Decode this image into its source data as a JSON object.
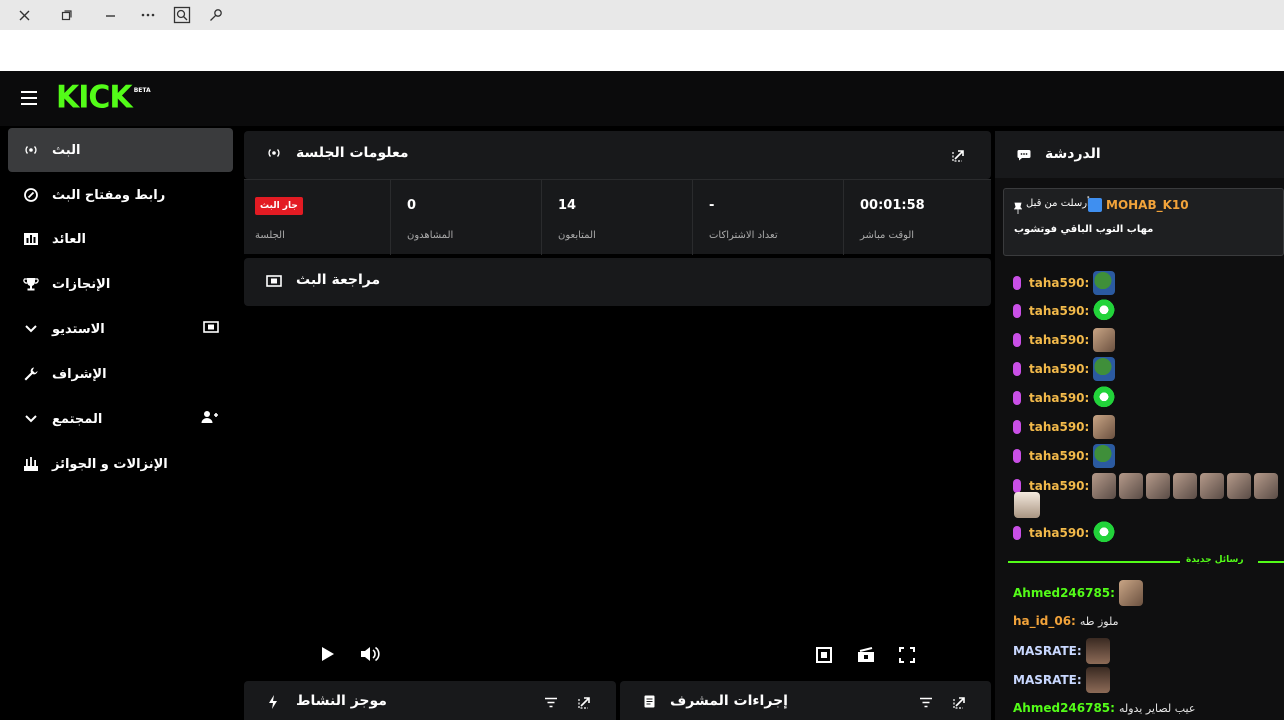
{
  "topbar": {
    "icons": [
      "close-icon",
      "restore-icon",
      "minimize-icon",
      "more-icon",
      "zoom-icon",
      "key-icon"
    ]
  },
  "header": {
    "logo": "KICK",
    "logo_badge": "BETA"
  },
  "sidebar": {
    "items": [
      {
        "label": "البث",
        "icon": "broadcast-icon",
        "active": true
      },
      {
        "label": "رابط ومفتاح البث",
        "icon": "link-icon"
      },
      {
        "label": "العائد",
        "icon": "chart-icon"
      },
      {
        "label": "الإنجازات",
        "icon": "trophy-icon"
      },
      {
        "label": "الاستديو",
        "icon": "studio-icon",
        "expandable": true
      },
      {
        "label": "الإشراف",
        "icon": "wrench-icon"
      },
      {
        "label": "المجتمع",
        "icon": "community-icon",
        "expandable": true
      },
      {
        "label": "الإنزالات و الجوائز",
        "icon": "gift-icon"
      }
    ]
  },
  "session_panel": {
    "title": "معلومات الجلسة",
    "stats": [
      {
        "value": "00:01:58",
        "label": "الوقت مباشر"
      },
      {
        "value": "-",
        "label": "تعداد الاشتراكات"
      },
      {
        "value": "14",
        "label": "المتابعون"
      },
      {
        "value": "0",
        "label": "المشاهدون"
      },
      {
        "badge": "جار البث",
        "label": "الجلسة"
      }
    ]
  },
  "preview_panel": {
    "title": "مراجعة البث"
  },
  "activity_panel": {
    "title": "موجز النشاط"
  },
  "mod_panel": {
    "title": "إجراءات المشرف"
  },
  "chat": {
    "title": "الدردشة",
    "pinned": {
      "user": "MOHAB_K10",
      "sent_by": "أرسلت من قبل",
      "message": "مهاب التوب الباقي فوتشوب"
    },
    "repeated_user": "taha590:",
    "divider_label": "رسائل جديدة",
    "new_messages": [
      {
        "user": "Ahmed246785:",
        "text": ""
      },
      {
        "user": "ha_id_06:",
        "text": "ملوز طه"
      },
      {
        "user": "MASRATE:",
        "text": ""
      },
      {
        "user": "MASRATE:",
        "text": ""
      },
      {
        "user": "Ahmed246785:",
        "text": "عيب لصاير يدوله"
      }
    ]
  }
}
